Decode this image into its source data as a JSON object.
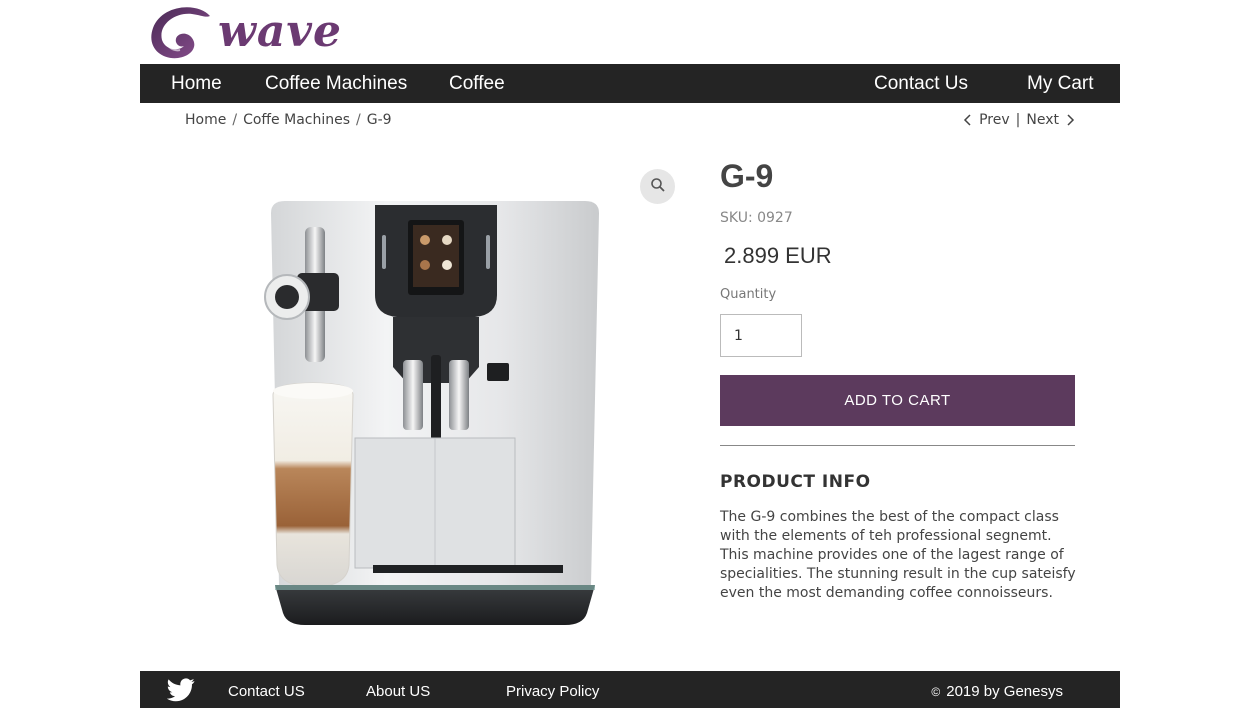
{
  "brand": {
    "logo_text": "wave",
    "accent": "#5c3a5d"
  },
  "nav": {
    "home": "Home",
    "coffee_machines": "Coffee Machines",
    "coffee": "Coffee",
    "contact": "Contact Us",
    "cart": "My Cart"
  },
  "breadcrumb": {
    "home": "Home",
    "sep": "/",
    "category": "Coffe Machines",
    "current": "G-9"
  },
  "pager": {
    "prev": "Prev",
    "divider": "|",
    "next": "Next"
  },
  "product": {
    "title": "G-9",
    "sku": "SKU: 0927",
    "price": "2.899 EUR",
    "quantity_label": "Quantity",
    "quantity_value": "1",
    "add_to_cart": "ADD TO CART",
    "info_heading": "PRODUCT INFO",
    "info_text": "The G-9 combines the best of the compact class with the elements of teh professional segnemt. This machine provides one of the lagest range of specialities. The stunning result in the cup sateisfy even the most demanding coffee connoisseurs."
  },
  "footer": {
    "contact": "Contact US",
    "about": "About US",
    "privacy": "Privacy Policy",
    "copyright_symbol": "©",
    "copyright": "2019 by Genesys"
  }
}
